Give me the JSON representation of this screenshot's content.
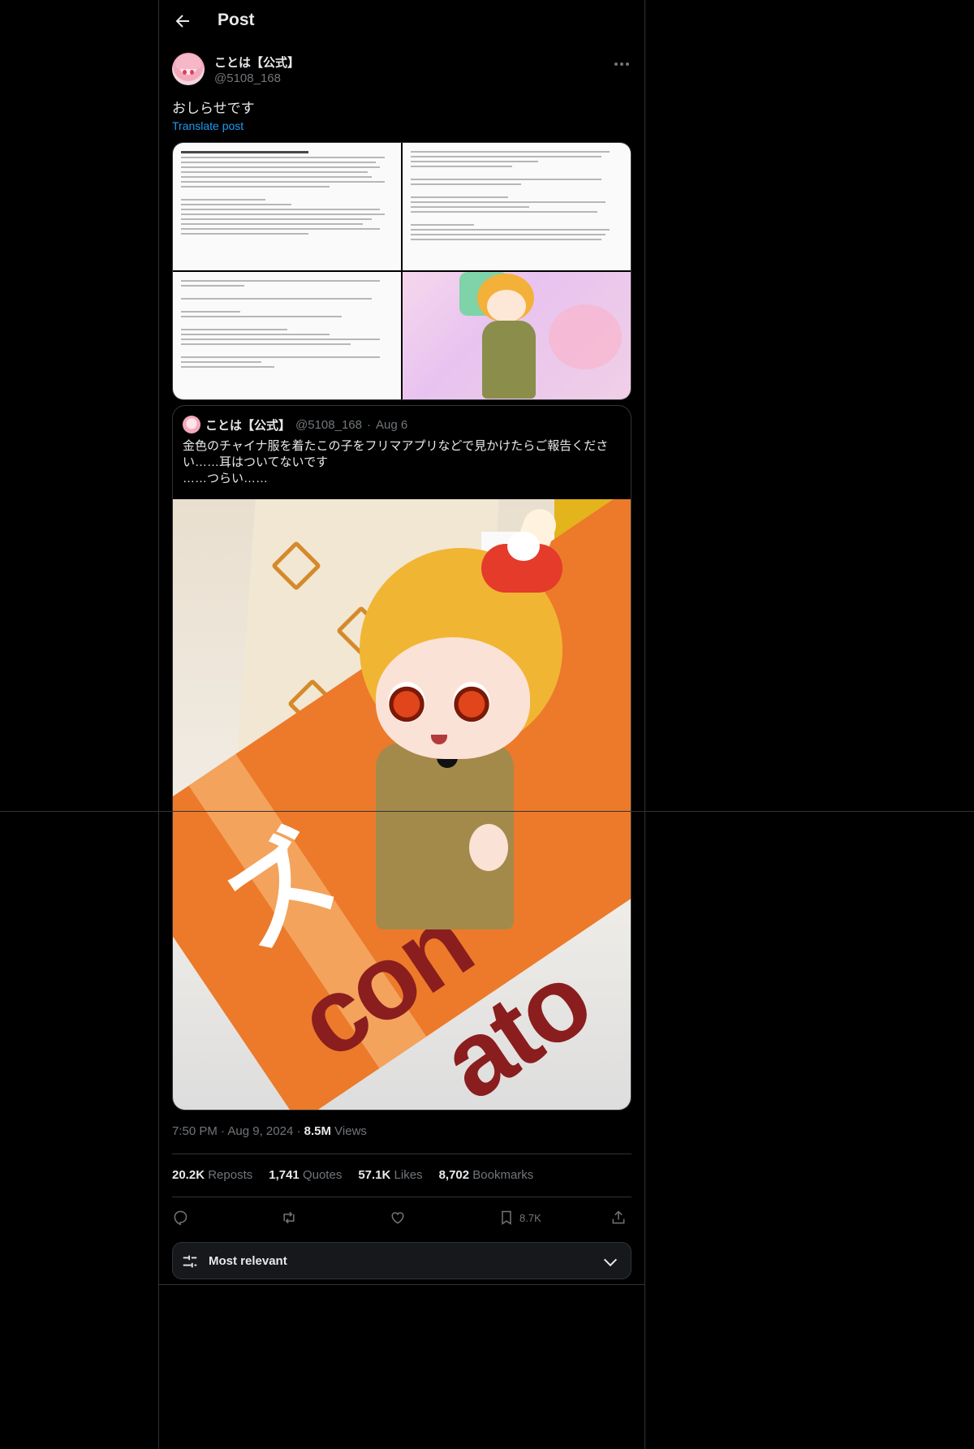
{
  "header": {
    "title": "Post"
  },
  "post": {
    "author": {
      "display_name": "ことは【公式】",
      "handle": "@5108_168"
    },
    "text": "おしらせです",
    "translate_label": "Translate post",
    "images": [
      {
        "kind": "document-screenshot"
      },
      {
        "kind": "document-screenshot"
      },
      {
        "kind": "document-screenshot"
      },
      {
        "kind": "photo-doll"
      }
    ],
    "quote": {
      "display_name": "ことは【公式】",
      "handle": "@5108_168",
      "separator": "·",
      "date": "Aug 6",
      "lines": [
        "金色のチャイナ服を着たこの子をフリマアプリなどで見かけたらご報告くださ",
        "い……耳はついてないです",
        "……つらい……"
      ]
    },
    "time": "7:50 PM",
    "separator": "·",
    "date": "Aug 9, 2024",
    "views_count": "8.5M",
    "views_label": "Views"
  },
  "stats": {
    "reposts": {
      "count": "20.2K",
      "label": "Reposts"
    },
    "quotes": {
      "count": "1,741",
      "label": "Quotes"
    },
    "likes": {
      "count": "57.1K",
      "label": "Likes"
    },
    "bookmarks": {
      "count": "8,702",
      "label": "Bookmarks"
    }
  },
  "actions": {
    "bookmark_count": "8.7K"
  },
  "sort": {
    "label": "Most relevant"
  },
  "colors": {
    "background": "#000000",
    "text": "#e7e9ea",
    "muted": "#71767b",
    "link": "#1d9bf0",
    "border": "#2f3336"
  }
}
